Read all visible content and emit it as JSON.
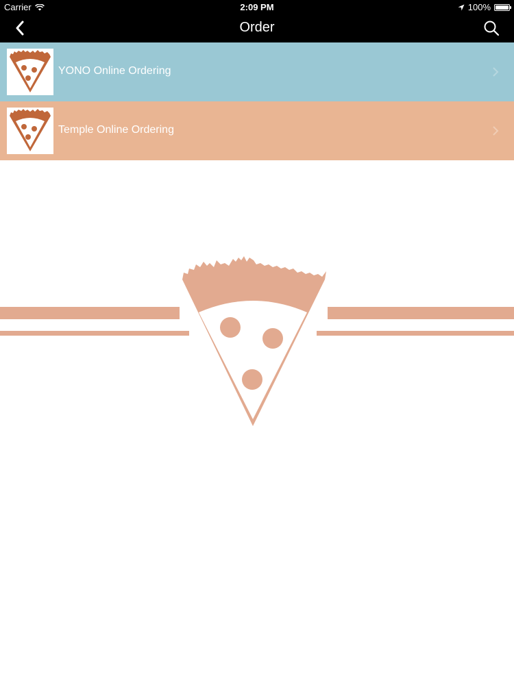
{
  "status_bar": {
    "carrier": "Carrier",
    "time": "2:09 PM",
    "battery": "100%",
    "battery_level": 1.0
  },
  "nav": {
    "title": "Order",
    "back_icon": "chevron-left-icon",
    "search_icon": "search-icon"
  },
  "list": {
    "items": [
      {
        "label": "YONO Online Ordering",
        "color": "#9ac8d4"
      },
      {
        "label": "Temple Online Ordering",
        "color": "#e9b593"
      }
    ]
  },
  "colors": {
    "bar": "#000000",
    "logo_accent": "#c0673a",
    "hero_logo": "#e2aa90"
  }
}
